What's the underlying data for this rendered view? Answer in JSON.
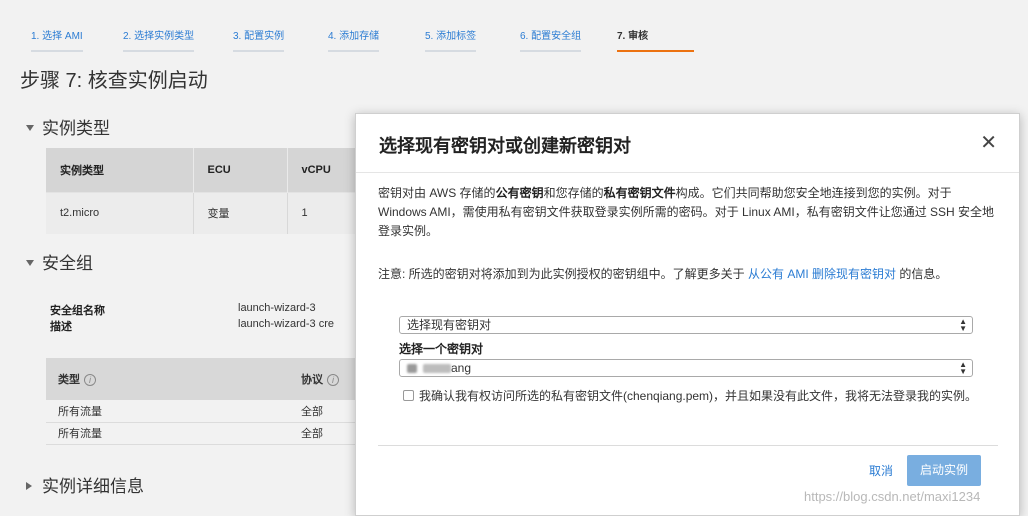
{
  "wizard": {
    "steps": [
      {
        "label": "1. 选择 AMI"
      },
      {
        "label": "2. 选择实例类型"
      },
      {
        "label": "3. 配置实例"
      },
      {
        "label": "4. 添加存储"
      },
      {
        "label": "5. 添加标签"
      },
      {
        "label": "6. 配置安全组"
      },
      {
        "label": "7. 审核"
      }
    ]
  },
  "page": {
    "title": "步骤 7: 核查实例启动"
  },
  "instance_type": {
    "heading": "实例类型",
    "columns": [
      "实例类型",
      "ECU",
      "vCPU"
    ],
    "rows": [
      [
        "t2.micro",
        "变量",
        "1"
      ]
    ]
  },
  "security_group": {
    "heading": "安全组",
    "name_label": "安全组名称",
    "name_value": "launch-wizard-3",
    "desc_label": "描述",
    "desc_value": "launch-wizard-3 cre",
    "columns": [
      "类型",
      "协议"
    ],
    "rows": [
      [
        "所有流量",
        "全部"
      ],
      [
        "所有流量",
        "全部"
      ]
    ]
  },
  "instance_details": {
    "heading": "实例详细信息"
  },
  "modal": {
    "title": "选择现有密钥对或创建新密钥对",
    "close": "✕",
    "para1_a": "密钥对由 AWS 存储的",
    "para1_b": "公有密钥",
    "para1_c": "和您存储的",
    "para1_d": "私有密钥文件",
    "para1_e": "构成。它们共同帮助您安全地连接到您的实例。对于 Windows AMI，需使用私有密钥文件获取登录实例所需的密码。对于 Linux AMI，私有密钥文件让您通过 SSH 安全地登录实例。",
    "para2_a": "注意: 所选的密钥对将添加到为此实例授权的密钥组中。了解更多关于",
    "para2_link": "从公有 AMI 删除现有密钥对",
    "para2_b": "的信息。",
    "select1_value": "选择现有密钥对",
    "select_label": "选择一个密钥对",
    "select2_value": "ang",
    "ack_text": "我确认我有权访问所选的私有密钥文件(chenqiang.pem)，并且如果没有此文件，我将无法登录我的实例。",
    "cancel": "取消",
    "launch": "启动实例"
  },
  "watermark": "https://blog.csdn.net/maxi1234"
}
